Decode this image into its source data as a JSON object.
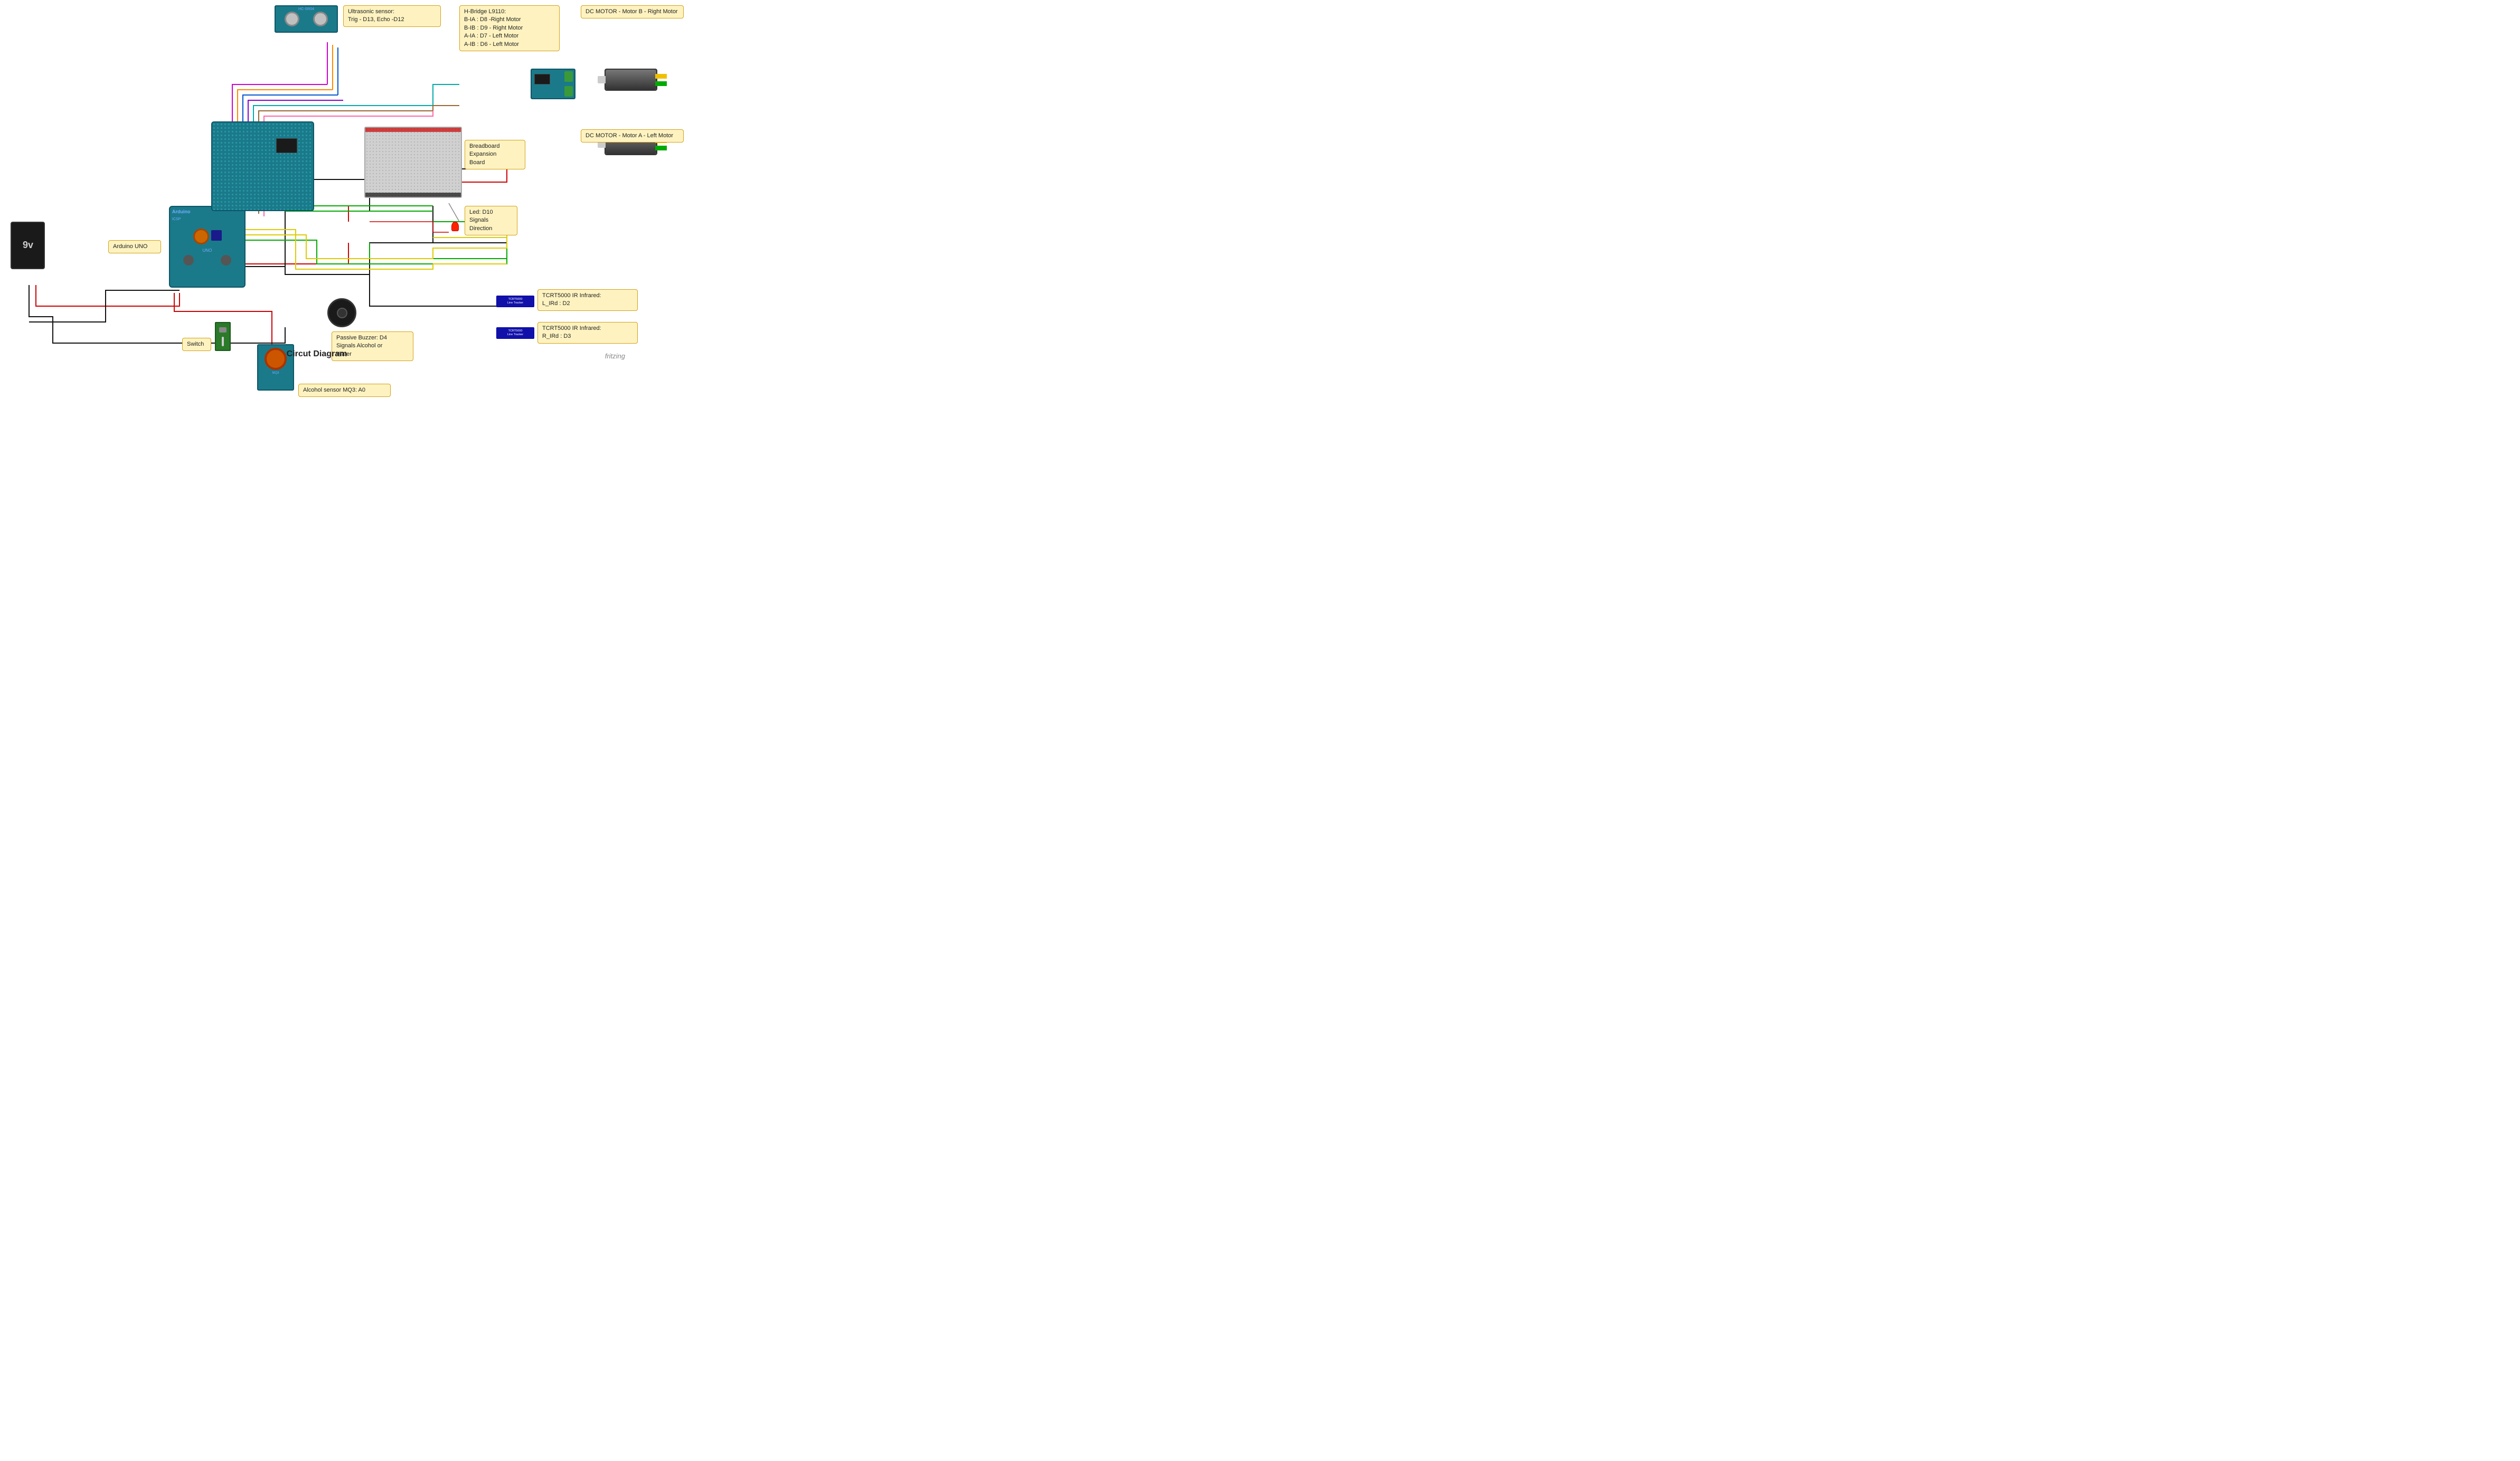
{
  "title": "Circut Diagram",
  "watermark": "fritzing",
  "labels": {
    "ultrasonic": "Ultrasonic sensor:\nTrig - D13, Echo -D12",
    "hbridge": "H-Bridge L9110:\nB-IA : D8 -Right Motor\nB-IB : D9 - Right Motor\nA-IA : D7 - Left Motor\nA-IB : D6 - Left Motor",
    "motor_b": "DC MOTOR - Motor B - Right Motor",
    "motor_a": "DC MOTOR - Motor A - Left Motor",
    "breadboard": "Breadboard\nExpansion\nBoard",
    "led": "Led: D10\nSignals\nDirection",
    "arduino": "Arduino UNO",
    "ir1": "TCRT5000 IR Infrared:\nL_IRd : D2",
    "ir2": "TCRT5000 IR Infrared:\nR_IRd : D3",
    "buzzer": "Passive Buzzer: D4\nSignals Alcohol or\nWater",
    "alcohol": "Alcohol sensor MQ3: A0",
    "switch": "Switch"
  },
  "ir_sensor_text": "TCRT5000\nLine Tracker",
  "battery_label": "9v",
  "colors": {
    "accent_yellow": "#fef3c0",
    "accent_border": "#d4a017",
    "wire_red": "#cc0000",
    "wire_black": "#111111",
    "wire_green": "#00aa00",
    "wire_yellow": "#ddcc00",
    "wire_blue": "#0000cc",
    "wire_magenta": "#cc00cc",
    "wire_orange": "#ff8800",
    "wire_cyan": "#00cccc",
    "wire_purple": "#8800cc",
    "wire_pink": "#ff66aa",
    "wire_brown": "#996633"
  }
}
